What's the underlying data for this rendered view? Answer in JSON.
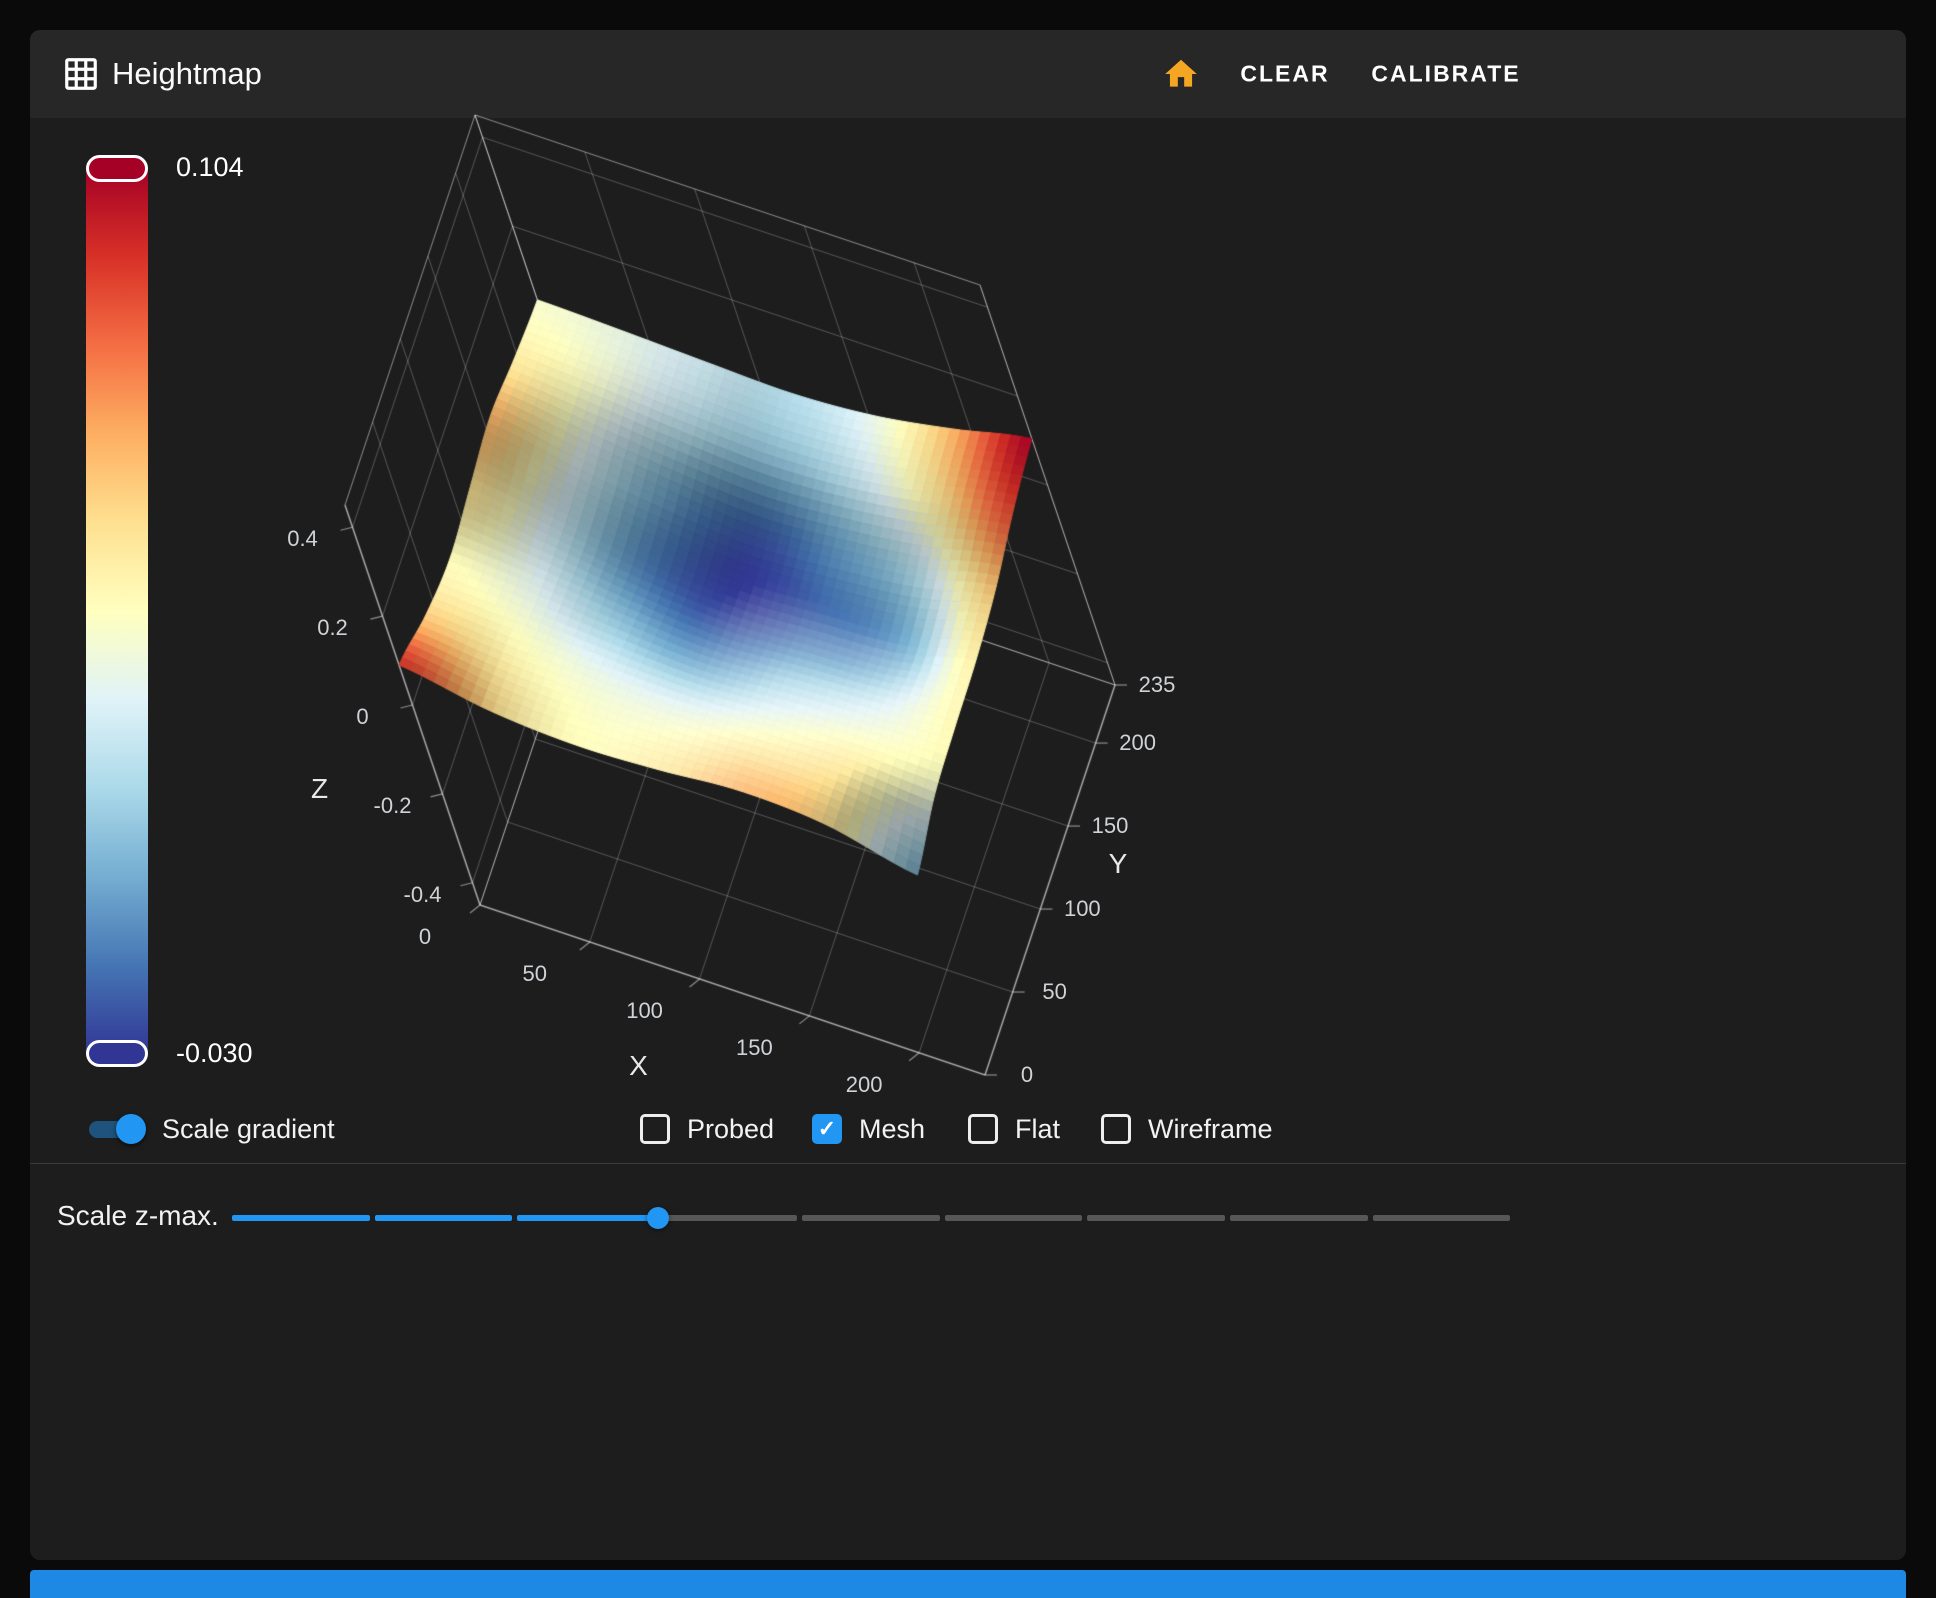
{
  "colors": {
    "accent_blue": "#2196f3",
    "home_icon": "#f5a623",
    "bottom_bar": "#1e88e5",
    "colorbar_top": "#a50026",
    "colorbar_bottom": "#313695"
  },
  "icons": {
    "check_glyph": "✓"
  },
  "header": {
    "title": "Heightmap",
    "clear_label": "CLEAR",
    "calibrate_label": "CALIBRATE"
  },
  "colorbar": {
    "max_label": "0.104",
    "min_label": "-0.030"
  },
  "controls": {
    "scale_gradient": {
      "label": "Scale gradient",
      "on": true
    },
    "display_modes": [
      {
        "label": "Probed",
        "checked": false
      },
      {
        "label": "Mesh",
        "checked": true
      },
      {
        "label": "Flat",
        "checked": false
      },
      {
        "label": "Wireframe",
        "checked": false
      }
    ]
  },
  "slider": {
    "label": "Scale z-max.",
    "fraction": 0.333,
    "segments": 9
  },
  "chart_data": {
    "type": "surface",
    "title": "Heightmap",
    "xlabel": "X",
    "ylabel": "Y",
    "zlabel": "Z",
    "x_ticks": [
      "0",
      "50",
      "100",
      "150",
      "200"
    ],
    "y_ticks": [
      "0",
      "50",
      "100",
      "150",
      "200",
      "235"
    ],
    "z_ticks": [
      "-0.4",
      "-0.2",
      "0",
      "0.2",
      "0.4"
    ],
    "x_range": [
      0,
      230
    ],
    "y_range": [
      0,
      235
    ],
    "z_range": [
      -0.45,
      0.45
    ],
    "color_min": -0.03,
    "color_max": 0.104,
    "colorscale_top_to_bottom": [
      "#a50026",
      "#d73027",
      "#f46d43",
      "#fdae61",
      "#fee090",
      "#ffffbf",
      "#e0f3f8",
      "#abd9e9",
      "#74add1",
      "#4575b4",
      "#313695"
    ],
    "mesh_z_rows_front_to_back": [
      [
        0.09,
        0.052,
        0.038,
        0.046,
        0.062,
        0.05,
        0.0
      ],
      [
        0.056,
        0.04,
        0.03,
        0.028,
        0.038,
        0.044,
        0.032
      ],
      [
        0.038,
        0.026,
        0.006,
        -0.006,
        0.01,
        0.022,
        0.04
      ],
      [
        0.05,
        0.018,
        -0.014,
        -0.028,
        -0.018,
        -0.004,
        0.044
      ],
      [
        0.062,
        0.024,
        -0.006,
        -0.024,
        -0.01,
        0.012,
        0.058
      ],
      [
        0.046,
        0.032,
        0.014,
        0.004,
        0.016,
        0.046,
        0.086
      ],
      [
        0.034,
        0.028,
        0.02,
        0.014,
        0.028,
        0.062,
        0.104
      ]
    ]
  }
}
